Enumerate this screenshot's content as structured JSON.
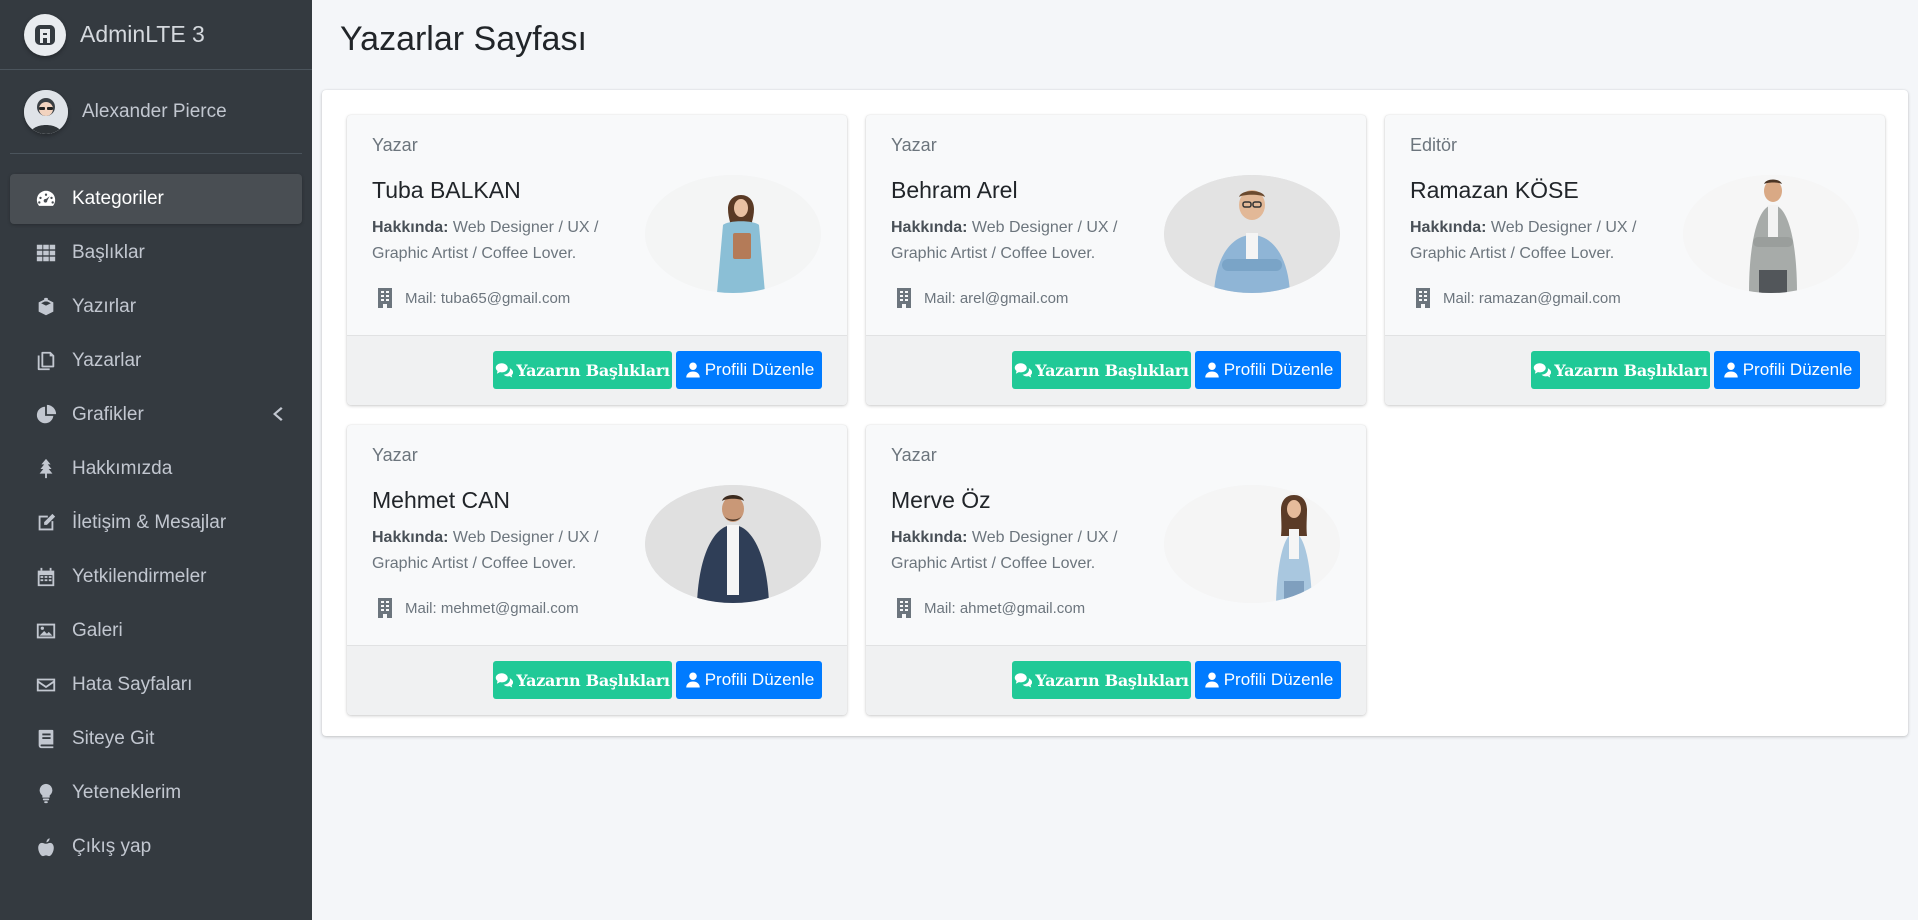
{
  "brand": {
    "name": "AdminLTE 3"
  },
  "user": {
    "name": "Alexander Pierce"
  },
  "sidebar": {
    "items": [
      {
        "label": "Kategoriler",
        "icon": "dashboard-gauge-icon",
        "active": true
      },
      {
        "label": "Başlıklar",
        "icon": "grid-icon"
      },
      {
        "label": "Yazırlar",
        "icon": "box-icon"
      },
      {
        "label": "Yazarlar",
        "icon": "copy-icon"
      },
      {
        "label": "Grafikler",
        "icon": "pie-chart-icon",
        "has_arrow": true
      },
      {
        "label": "Hakkımızda",
        "icon": "tree-icon"
      },
      {
        "label": "İletişim & Mesajlar",
        "icon": "edit-icon"
      },
      {
        "label": "Yetkilendirmeler",
        "icon": "calendar-icon"
      },
      {
        "label": "Galeri",
        "icon": "image-icon"
      },
      {
        "label": "Hata Sayfaları",
        "icon": "envelope-icon"
      },
      {
        "label": "Siteye Git",
        "icon": "book-icon"
      },
      {
        "label": "Yeteneklerim",
        "icon": "lightbulb-icon"
      },
      {
        "label": "Çıkış yap",
        "icon": "apple-icon"
      }
    ]
  },
  "page": {
    "title": "Yazarlar Sayfası"
  },
  "cards": [
    {
      "role": "Yazar",
      "name": "Tuba BALKAN",
      "about_label": "Hakkında:",
      "about_text": " Web Designer / UX / Graphic Artist / Coffee Lover.",
      "mail": "Mail: tuba65@gmail.com",
      "btn_titles": "Yazarın Başlıkları",
      "btn_edit": "Profili Düzenle"
    },
    {
      "role": "Yazar",
      "name": "Behram Arel",
      "about_label": "Hakkında:",
      "about_text": " Web Designer / UX / Graphic Artist / Coffee Lover.",
      "mail": "Mail: arel@gmail.com",
      "btn_titles": "Yazarın Başlıkları",
      "btn_edit": "Profili Düzenle"
    },
    {
      "role": "Editör",
      "name": "Ramazan KÖSE",
      "about_label": "Hakkında:",
      "about_text": " Web Designer / UX / Graphic Artist / Coffee Lover.",
      "mail": "Mail: ramazan@gmail.com",
      "btn_titles": "Yazarın Başlıkları",
      "btn_edit": "Profili Düzenle"
    },
    {
      "role": "Yazar",
      "name": "Mehmet CAN",
      "about_label": "Hakkında:",
      "about_text": " Web Designer / UX / Graphic Artist / Coffee Lover.",
      "mail": "Mail: mehmet@gmail.com",
      "btn_titles": "Yazarın Başlıkları",
      "btn_edit": "Profili Düzenle"
    },
    {
      "role": "Yazar",
      "name": "Merve Öz",
      "about_label": "Hakkında:",
      "about_text": " Web Designer / UX / Graphic Artist / Coffee Lover.",
      "mail": "Mail: ahmet@gmail.com",
      "btn_titles": "Yazarın Başlıkları",
      "btn_edit": "Profili Düzenle"
    }
  ],
  "colors": {
    "sidebar_bg": "#343a40",
    "green_button": "#20c997",
    "blue_button": "#007bff",
    "content_bg": "#f4f6f9"
  }
}
